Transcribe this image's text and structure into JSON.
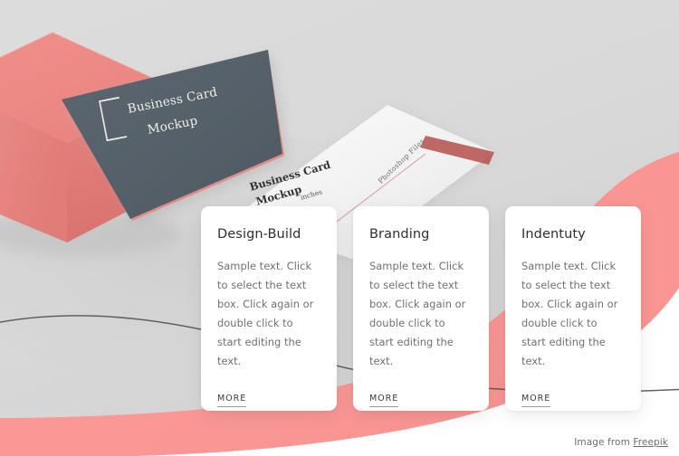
{
  "page": {
    "background_color": "#d9d9d9",
    "accent_pink": "#fa9a98",
    "dark_card_color": "#55606a",
    "white_area_color": "#ffffff"
  },
  "hero_mockup": {
    "dark_card": {
      "logo_icon": "square-bracket-logo-icon",
      "line1": "Business Card",
      "line2": "Mockup"
    },
    "white_card": {
      "line1": "Business Card",
      "line2": "Mockup",
      "size_note": "inches",
      "side_note": "Photoshop Files"
    }
  },
  "cards": [
    {
      "title": "Design-Build",
      "body": "Sample text. Click to select the text box. Click again or double click to start editing the text.",
      "more_label": "MORE"
    },
    {
      "title": "Branding",
      "body": "Sample text. Click to select the text box. Click again or double click to start editing the text.",
      "more_label": "MORE"
    },
    {
      "title": "Indentuty",
      "body": "Sample text. Click to select the text box. Click again or double click to start editing the text.",
      "more_label": "MORE"
    }
  ],
  "attribution": {
    "prefix": "Image from ",
    "link_label": "Freepik"
  }
}
